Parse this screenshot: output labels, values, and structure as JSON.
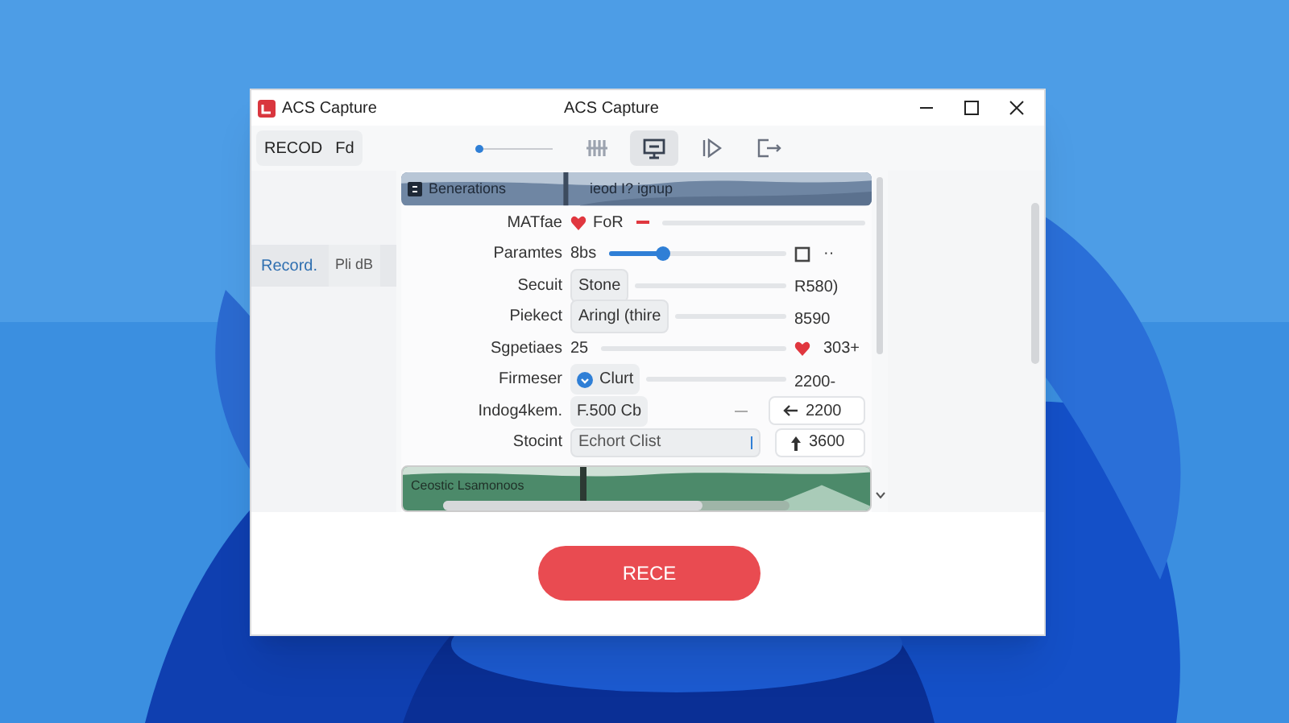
{
  "window": {
    "title": "ACS Capture",
    "app_name": "ACS Capture"
  },
  "toolbar": {
    "left_button": {
      "label": "RECOD",
      "extra": "Fd"
    },
    "slider": {
      "level": 0.0
    },
    "tools": [
      {
        "kind": "grip",
        "selected": false
      },
      {
        "kind": "screen",
        "selected": true
      },
      {
        "kind": "play",
        "selected": false
      },
      {
        "kind": "export",
        "selected": false
      }
    ]
  },
  "sidebar": {
    "items": [
      {
        "label": "Record.",
        "value": "Pli dB",
        "selected": true
      }
    ]
  },
  "banner": {
    "title": "Benerations",
    "subtitle": "ieod I? ignup"
  },
  "rows": [
    {
      "label": "MATfae",
      "kind": "heart-text",
      "value": "FoR"
    },
    {
      "label": "Paramtes",
      "kind": "slider",
      "value": "8bs",
      "level": 0.3,
      "right": {
        "kind": "square",
        "text": "··"
      }
    },
    {
      "label": "Secuit",
      "kind": "chip",
      "value": "Stone",
      "right": {
        "kind": "plain",
        "text": "R580)"
      }
    },
    {
      "label": "Piekect",
      "kind": "chip",
      "value": "Aringl (thire",
      "right": {
        "kind": "plain",
        "text": "8590"
      }
    },
    {
      "label": "Sgpetiaes",
      "kind": "text",
      "value": "25",
      "right": {
        "kind": "heart",
        "text": "303+"
      }
    },
    {
      "label": "Firmeser",
      "kind": "check-chip",
      "value": "Clurt",
      "right": {
        "kind": "plain",
        "text": "2200-"
      }
    },
    {
      "label": "Indog4kem.",
      "kind": "chip-plain",
      "value": "F.500 Cb",
      "right": {
        "kind": "arrow-left",
        "text": "2200"
      }
    },
    {
      "label": "Stocint",
      "kind": "field",
      "value": "Echort Clist",
      "right": {
        "kind": "arrow-up",
        "text": "3600"
      }
    }
  ],
  "footer_banner": {
    "title": "Ceostic Lsamonoos",
    "level": 0.75
  },
  "record_button": "RECE"
}
